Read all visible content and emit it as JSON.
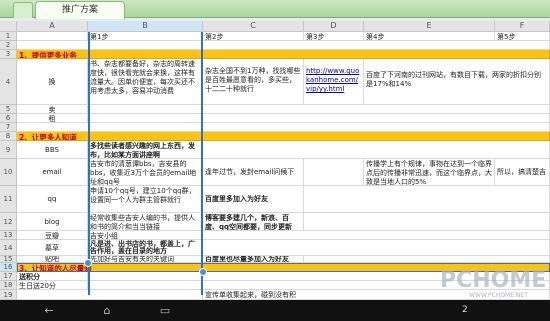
{
  "tabs": {
    "active_label": "推广方案"
  },
  "columns": [
    "A",
    "B",
    "C",
    "D",
    "E",
    "F"
  ],
  "rows": {
    "r1": {
      "num": "1",
      "b": "第1步",
      "c": "第2步",
      "d": "第3步",
      "e": "第4步",
      "f": "第5步"
    },
    "r2": {
      "num": "2"
    },
    "r3": {
      "num": "3",
      "a": "1、提供更多业务"
    },
    "r4": {
      "num": "4",
      "a": "换",
      "b": "书、杂志都要备好，杂志的周转速度快，很快看完就会来换，这样有流量大。因单价便宜，每次买还不用考虑太多，容易冲动消费",
      "c": "杂志全国不到1万种，找找哪些是百姓最愿意看的，多买些，十二二十种就行",
      "d": "http://www.guokanhome.com/vip/yy.html",
      "e": "百度了下河南的过刊网站，有数目下载，两家的折扣分别是17%和14%"
    },
    "r5": {
      "num": "5",
      "a": "卖"
    },
    "r6": {
      "num": "6",
      "a": "租"
    },
    "r7": {
      "num": "7"
    },
    "r8": {
      "num": "8",
      "a": "2、让更多人知道"
    },
    "r9": {
      "num": "9",
      "a": "BBS",
      "b": "多找些读者感兴趣的网上东西，发布，比如某方面讲座啊"
    },
    "r10": {
      "num": "10",
      "a": "email",
      "b": "吉安市的清葱谭bbs，吉安县的bbs，收集近3万个会员的email地址和qq号",
      "c": "逢年过节，发封email问候下",
      "e": "传播学上有个规律，事物在达到一个临界点后的传播非常迅速，而这个临界点，大致是当地人口的5%",
      "f": "所以，搞清楚吉"
    },
    "r11": {
      "num": "11",
      "a": "qq",
      "b": "申请10个qq号，建立10个qq群，设置同一个人为群主管群就行",
      "c": "百度里多加入为好友"
    },
    "r12": {
      "num": "12",
      "a": "blog",
      "b": "经常收集些吉安人编的书，提供人和书的简介和当当链接",
      "c": "博客要多建几个，新浪、百度、qq空间都要，同步更新"
    },
    "r13": {
      "num": "13",
      "a": "豆瓣",
      "b": "吉安小组"
    },
    "r14": {
      "num": "14",
      "a": "墓草",
      "b": "凡是进、出书店的书，都盖上，广告作用，盖在目录的地方"
    },
    "r15": {
      "num": "15",
      "a": "贴吧",
      "b": "先加好与吉安有关的关键词",
      "c": "百度里也尽量多加入为好友"
    },
    "r16": {
      "num": "16",
      "a": "3、让知道的人尽量知"
    },
    "r17": {
      "num": "17",
      "a": "送积分"
    },
    "r18": {
      "num": "18",
      "a": "生日送20分"
    },
    "r19": {
      "num": "19",
      "c": "宣传单收集起来，碰到没有积"
    }
  },
  "watermark": {
    "text": "PCHOME",
    "url": "WWW.PCHOME.NET"
  },
  "statusbar": {
    "clock": "2"
  },
  "colors": {
    "section": "#ffc20e",
    "section_text": "#c00000",
    "selection": "#2b74c7"
  }
}
